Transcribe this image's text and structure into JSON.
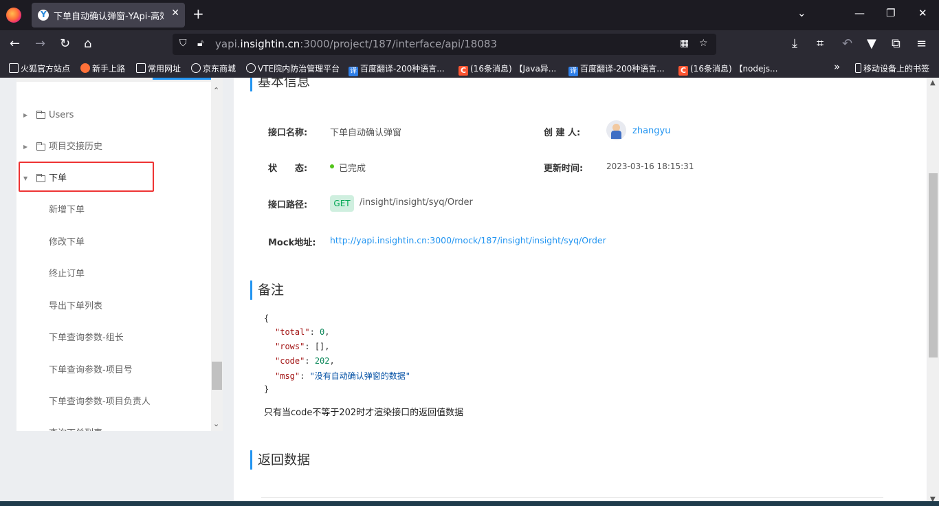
{
  "browser": {
    "tab_title": "下单自动确认弹窗-YApi-高效、易用、功能强大的可视化接口管理平台",
    "tab_close": "✕",
    "new_tab": "+",
    "url_host_prefix": "yapi.",
    "url_host_main": "insightin.cn",
    "url_rest": ":3000/project/187/interface/api/18083",
    "overflow_label": "»",
    "mobile_bookmarks": "移动设备上的书签",
    "bookmarks": [
      {
        "icon": "folder-icon",
        "label": "火狐官方站点"
      },
      {
        "icon": "firefox-icon",
        "label": "新手上路"
      },
      {
        "icon": "folder-icon",
        "label": "常用网址"
      },
      {
        "icon": "globe-icon",
        "label": "京东商城"
      },
      {
        "icon": "globe-icon",
        "label": "VTE院内防治管理平台"
      },
      {
        "icon": "baidu-translate-icon",
        "label": "百度翻译-200种语言..."
      },
      {
        "icon": "csdn-icon",
        "label": "(16条消息) 【Java异..."
      },
      {
        "icon": "baidu-translate-icon",
        "label": "百度翻译-200种语言..."
      },
      {
        "icon": "csdn-icon",
        "label": "(16条消息) 【nodejs..."
      }
    ]
  },
  "sidebar": {
    "folders": [
      {
        "label": "Users",
        "expanded": false
      },
      {
        "label": "项目交接历史",
        "expanded": false
      },
      {
        "label": "下单",
        "expanded": true
      }
    ],
    "children": [
      "新增下单",
      "修改下单",
      "终止订单",
      "导出下单列表",
      "下单查询参数-组长",
      "下单查询参数-项目号",
      "下单查询参数-项目负责人",
      "查询下单列表"
    ]
  },
  "main": {
    "basic_title": "基本信息",
    "fields": {
      "name_label": "接口名称:",
      "name_value": "下单自动确认弹窗",
      "creator_label": "创 建 人:",
      "creator_value": "zhangyu",
      "status_label": "状　　态:",
      "status_value": "已完成",
      "updated_label": "更新时间:",
      "updated_value": "2023-03-16 18:15:31",
      "path_label": "接口路径:",
      "method": "GET",
      "path_value": "/insight/insight/syq/Order",
      "mock_label": "Mock地址:",
      "mock_value": "http://yapi.insightin.cn:3000/mock/187/insight/insight/syq/Order"
    },
    "remark_title": "备注",
    "json_lines": {
      "open": "{",
      "total_key": "\"total\"",
      "total_val": "0",
      "rows_key": "\"rows\"",
      "rows_val": "[]",
      "code_key": "\"code\"",
      "code_val": "202",
      "msg_key": "\"msg\"",
      "msg_val": "\"没有自动确认弹窗的数据\"",
      "close": "}"
    },
    "remark_text": "只有当code不等于202时才渲染接口的返回值数据",
    "return_title": "返回数据"
  },
  "colors": {
    "accent": "#2395f1",
    "status_done": "#52c41a",
    "get_bg": "#cfefdf",
    "highlight_box": "#e33333"
  }
}
